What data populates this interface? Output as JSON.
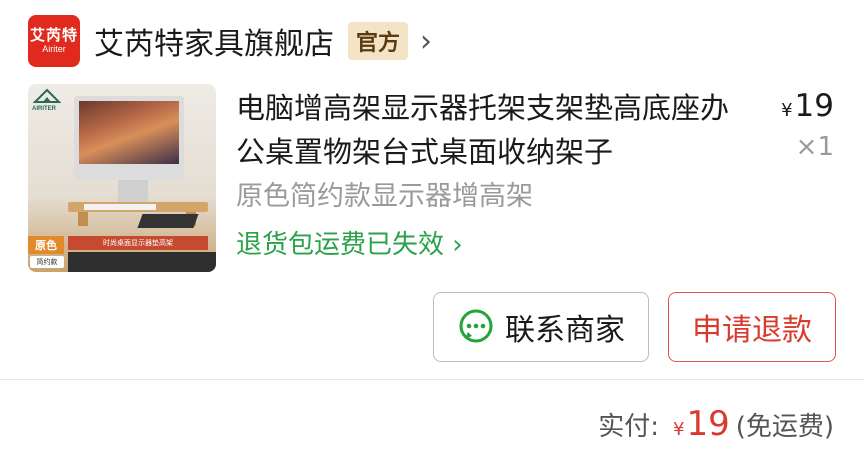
{
  "store": {
    "logo_line1": "艾芮特",
    "logo_line2": "Airiter",
    "name": "艾芮特家具旗舰店",
    "badge": "官方",
    "chevron": "›"
  },
  "product": {
    "image_brand": "AIRITER",
    "image_label_main": "原色",
    "image_label_sub": "简约款",
    "image_banner": "时尚桌面显示器垫高架",
    "title": "电脑增高架显示器托架支架垫高底座办公桌置物架台式桌面收纳架子",
    "price_symbol": "¥",
    "price": "19",
    "quantity": "×1",
    "variant": "原色简约款显示器增高架",
    "return_status": "退货包运费已失效"
  },
  "actions": {
    "contact_label": "联系商家",
    "refund_label": "申请退款"
  },
  "payment": {
    "label": "实付:",
    "symbol": "¥",
    "amount": "19",
    "shipping": "(免运费)"
  },
  "colors": {
    "accent_red": "#d93a2e",
    "green": "#2aa24a",
    "badge_bg": "#f3e3c7"
  }
}
